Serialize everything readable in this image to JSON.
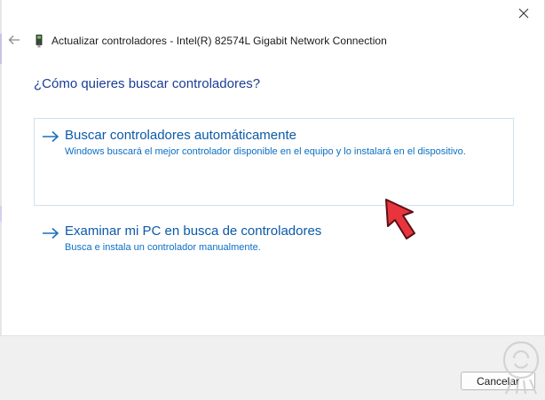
{
  "window": {
    "header_title": "Actualizar controladores - Intel(R) 82574L Gigabit Network Connection",
    "question": "¿Cómo quieres buscar controladores?"
  },
  "options": [
    {
      "title": "Buscar controladores automáticamente",
      "description": "Windows buscará el mejor controlador disponible en el equipo y lo instalará en el dispositivo.",
      "selected": true
    },
    {
      "title": "Examinar mi PC en busca de controladores",
      "description": "Busca e instala un controlador manualmente.",
      "selected": false
    }
  ],
  "footer": {
    "cancel_label": "Cancelar"
  },
  "icons": {
    "close": "close-icon",
    "back": "back-arrow-icon",
    "device": "network-device-icon",
    "option_arrow": "right-arrow-icon",
    "pointer": "red-pointer-arrow-icon",
    "watermark": "solvetic-logo-icon"
  },
  "colors": {
    "question": "#1b3d93",
    "option_title": "#0b5aa8",
    "option_description": "#0b6fc4",
    "pointer": "#e8353d",
    "footer_bg": "#f0f0f0"
  }
}
